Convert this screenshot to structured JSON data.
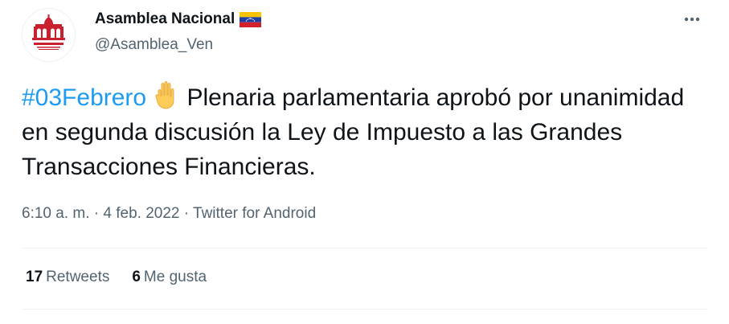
{
  "author": {
    "display_name": "Asamblea Nacional",
    "handle": "@Asamblea_Ven",
    "avatar_caption": "Asamblea Nacional",
    "flag_icon": "venezuela-flag-icon"
  },
  "menu": {
    "more_icon": "more-dots-icon"
  },
  "tweet": {
    "hashtag": "#03Febrero",
    "emoji_icon": "raised-hand-icon",
    "body": " Plenaria parlamentaria aprobó por unanimidad en segunda discusión la Ley de Impuesto a las Grandes Transacciones Financieras."
  },
  "meta": {
    "time": "6:10 a. m.",
    "sep1": " · ",
    "date": "4 feb. 2022",
    "sep2": " · ",
    "source": "Twitter for Android"
  },
  "stats": {
    "retweets_count": "17",
    "retweets_label": "Retweets",
    "likes_count": "6",
    "likes_label": "Me gusta"
  },
  "colors": {
    "accent": "#1d9bf0",
    "text": "#0f1419",
    "muted": "#536471",
    "logo_red": "#c8202f"
  }
}
